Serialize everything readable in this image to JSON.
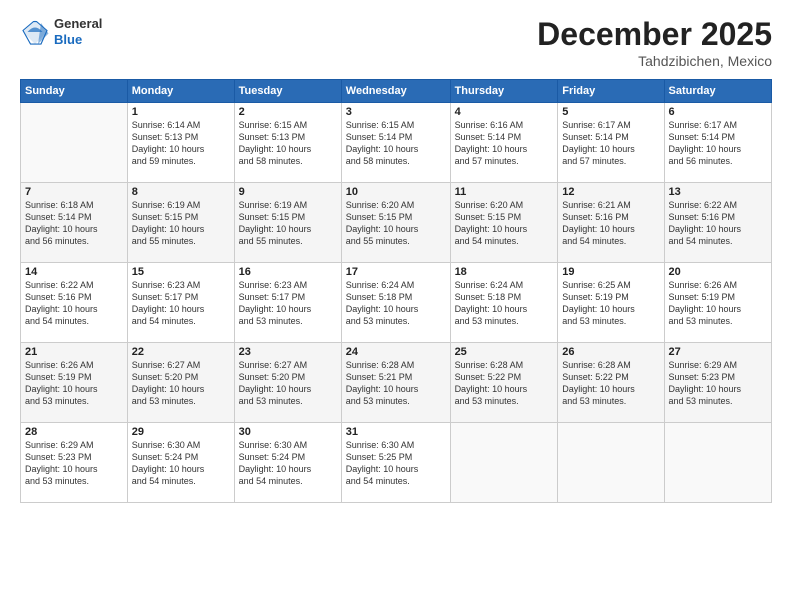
{
  "header": {
    "logo_general": "General",
    "logo_blue": "Blue",
    "month": "December 2025",
    "location": "Tahdzibichen, Mexico"
  },
  "days_of_week": [
    "Sunday",
    "Monday",
    "Tuesday",
    "Wednesday",
    "Thursday",
    "Friday",
    "Saturday"
  ],
  "weeks": [
    [
      {
        "day": "",
        "info": ""
      },
      {
        "day": "1",
        "info": "Sunrise: 6:14 AM\nSunset: 5:13 PM\nDaylight: 10 hours\nand 59 minutes."
      },
      {
        "day": "2",
        "info": "Sunrise: 6:15 AM\nSunset: 5:13 PM\nDaylight: 10 hours\nand 58 minutes."
      },
      {
        "day": "3",
        "info": "Sunrise: 6:15 AM\nSunset: 5:14 PM\nDaylight: 10 hours\nand 58 minutes."
      },
      {
        "day": "4",
        "info": "Sunrise: 6:16 AM\nSunset: 5:14 PM\nDaylight: 10 hours\nand 57 minutes."
      },
      {
        "day": "5",
        "info": "Sunrise: 6:17 AM\nSunset: 5:14 PM\nDaylight: 10 hours\nand 57 minutes."
      },
      {
        "day": "6",
        "info": "Sunrise: 6:17 AM\nSunset: 5:14 PM\nDaylight: 10 hours\nand 56 minutes."
      }
    ],
    [
      {
        "day": "7",
        "info": "Sunrise: 6:18 AM\nSunset: 5:14 PM\nDaylight: 10 hours\nand 56 minutes."
      },
      {
        "day": "8",
        "info": "Sunrise: 6:19 AM\nSunset: 5:15 PM\nDaylight: 10 hours\nand 55 minutes."
      },
      {
        "day": "9",
        "info": "Sunrise: 6:19 AM\nSunset: 5:15 PM\nDaylight: 10 hours\nand 55 minutes."
      },
      {
        "day": "10",
        "info": "Sunrise: 6:20 AM\nSunset: 5:15 PM\nDaylight: 10 hours\nand 55 minutes."
      },
      {
        "day": "11",
        "info": "Sunrise: 6:20 AM\nSunset: 5:15 PM\nDaylight: 10 hours\nand 54 minutes."
      },
      {
        "day": "12",
        "info": "Sunrise: 6:21 AM\nSunset: 5:16 PM\nDaylight: 10 hours\nand 54 minutes."
      },
      {
        "day": "13",
        "info": "Sunrise: 6:22 AM\nSunset: 5:16 PM\nDaylight: 10 hours\nand 54 minutes."
      }
    ],
    [
      {
        "day": "14",
        "info": "Sunrise: 6:22 AM\nSunset: 5:16 PM\nDaylight: 10 hours\nand 54 minutes."
      },
      {
        "day": "15",
        "info": "Sunrise: 6:23 AM\nSunset: 5:17 PM\nDaylight: 10 hours\nand 54 minutes."
      },
      {
        "day": "16",
        "info": "Sunrise: 6:23 AM\nSunset: 5:17 PM\nDaylight: 10 hours\nand 53 minutes."
      },
      {
        "day": "17",
        "info": "Sunrise: 6:24 AM\nSunset: 5:18 PM\nDaylight: 10 hours\nand 53 minutes."
      },
      {
        "day": "18",
        "info": "Sunrise: 6:24 AM\nSunset: 5:18 PM\nDaylight: 10 hours\nand 53 minutes."
      },
      {
        "day": "19",
        "info": "Sunrise: 6:25 AM\nSunset: 5:19 PM\nDaylight: 10 hours\nand 53 minutes."
      },
      {
        "day": "20",
        "info": "Sunrise: 6:26 AM\nSunset: 5:19 PM\nDaylight: 10 hours\nand 53 minutes."
      }
    ],
    [
      {
        "day": "21",
        "info": "Sunrise: 6:26 AM\nSunset: 5:19 PM\nDaylight: 10 hours\nand 53 minutes."
      },
      {
        "day": "22",
        "info": "Sunrise: 6:27 AM\nSunset: 5:20 PM\nDaylight: 10 hours\nand 53 minutes."
      },
      {
        "day": "23",
        "info": "Sunrise: 6:27 AM\nSunset: 5:20 PM\nDaylight: 10 hours\nand 53 minutes."
      },
      {
        "day": "24",
        "info": "Sunrise: 6:28 AM\nSunset: 5:21 PM\nDaylight: 10 hours\nand 53 minutes."
      },
      {
        "day": "25",
        "info": "Sunrise: 6:28 AM\nSunset: 5:22 PM\nDaylight: 10 hours\nand 53 minutes."
      },
      {
        "day": "26",
        "info": "Sunrise: 6:28 AM\nSunset: 5:22 PM\nDaylight: 10 hours\nand 53 minutes."
      },
      {
        "day": "27",
        "info": "Sunrise: 6:29 AM\nSunset: 5:23 PM\nDaylight: 10 hours\nand 53 minutes."
      }
    ],
    [
      {
        "day": "28",
        "info": "Sunrise: 6:29 AM\nSunset: 5:23 PM\nDaylight: 10 hours\nand 53 minutes."
      },
      {
        "day": "29",
        "info": "Sunrise: 6:30 AM\nSunset: 5:24 PM\nDaylight: 10 hours\nand 54 minutes."
      },
      {
        "day": "30",
        "info": "Sunrise: 6:30 AM\nSunset: 5:24 PM\nDaylight: 10 hours\nand 54 minutes."
      },
      {
        "day": "31",
        "info": "Sunrise: 6:30 AM\nSunset: 5:25 PM\nDaylight: 10 hours\nand 54 minutes."
      },
      {
        "day": "",
        "info": ""
      },
      {
        "day": "",
        "info": ""
      },
      {
        "day": "",
        "info": ""
      }
    ]
  ]
}
